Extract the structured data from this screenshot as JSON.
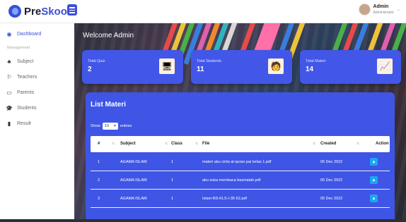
{
  "app": {
    "name_pre": "Pre",
    "name_post": "Skool"
  },
  "user": {
    "name": "Admin",
    "role": "Administrator"
  },
  "sidebar": {
    "items": [
      {
        "label": "Dashboard",
        "icon": "dashboard-icon",
        "glyph": "◉"
      },
      {
        "label": "Subject",
        "icon": "subject-icon",
        "glyph": "♣"
      },
      {
        "label": "Teachers",
        "icon": "teachers-icon",
        "glyph": "⚐"
      },
      {
        "label": "Parents",
        "icon": "parents-icon",
        "glyph": "▭"
      },
      {
        "label": "Students",
        "icon": "students-icon",
        "glyph": "🎓"
      },
      {
        "label": "Result",
        "icon": "result-icon",
        "glyph": "▮"
      }
    ],
    "section": "Management"
  },
  "hero": {
    "welcome": "Welcome Admin"
  },
  "cards": [
    {
      "label": "Total Quiz",
      "value": "2",
      "icon": "quiz-icon",
      "glyph": "🖥"
    },
    {
      "label": "Total Students",
      "value": "11",
      "icon": "student-icon",
      "glyph": "🧑"
    },
    {
      "label": "Total Materi",
      "value": "14",
      "icon": "materi-icon",
      "glyph": "📈"
    }
  ],
  "list": {
    "title": "List Materi",
    "show_label": "Show",
    "page_size": "10",
    "entries_label": "entries",
    "headers": [
      "#",
      "Subject",
      "Class",
      "File",
      "Created",
      "Action"
    ],
    "rows": [
      {
        "no": "1",
        "subject": "AGAMA ISLAM",
        "class": "1",
        "file": "materi aku cinta al-quran pai kelas 1.pdf",
        "created": "05 Dec 2022"
      },
      {
        "no": "2",
        "subject": "AGAMA ISLAM",
        "class": "1",
        "file": "aku suka membaca basmalah.pdf",
        "created": "05 Dec 2022"
      },
      {
        "no": "3",
        "subject": "AGAMA ISLAM",
        "class": "1",
        "file": "Islam-BS-KLS-I-35-52.pdf",
        "created": "05 Dec 2022"
      }
    ]
  },
  "colors": {
    "primary": "#3f55e6",
    "accent": "#1aa8f0",
    "active": "#3b4fd8"
  }
}
